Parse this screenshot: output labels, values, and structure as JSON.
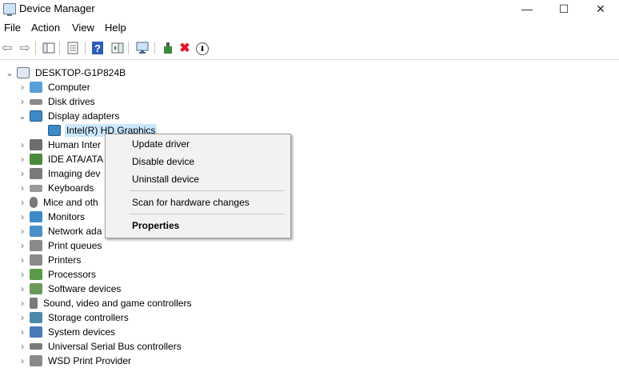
{
  "window": {
    "title": "Device Manager",
    "minimize_glyph": "—",
    "maximize_glyph": "☐",
    "close_glyph": "✕"
  },
  "menu": [
    "File",
    "Action",
    "View",
    "Help"
  ],
  "toolbar": {
    "back_glyph": "⇦",
    "forward_glyph": "⇨",
    "help_glyph": "?",
    "uninstall_glyph": "✖",
    "update_glyph": "⬇"
  },
  "tree": {
    "root": "DESKTOP-G1P824B",
    "expanded_category": "Display adapters",
    "selected_device": "Intel(R) HD Graphics",
    "categories_before": [
      "Computer",
      "Disk drives"
    ],
    "categories_after": [
      "Human Inter",
      "IDE ATA/ATA",
      "Imaging dev",
      "Keyboards",
      "Mice and oth",
      "Monitors",
      "Network ada",
      "Print queues",
      "Printers",
      "Processors",
      "Software devices",
      "Sound, video and game controllers",
      "Storage controllers",
      "System devices",
      "Universal Serial Bus controllers",
      "WSD Print Provider"
    ]
  },
  "context_menu": {
    "update_driver": "Update driver",
    "disable_device": "Disable device",
    "uninstall_device": "Uninstall device",
    "scan_hardware": "Scan for hardware changes",
    "properties": "Properties"
  },
  "colors": {
    "selection": "#cce8ff",
    "uninstall_red": "#e81123",
    "help_blue": "#2b5db8"
  }
}
